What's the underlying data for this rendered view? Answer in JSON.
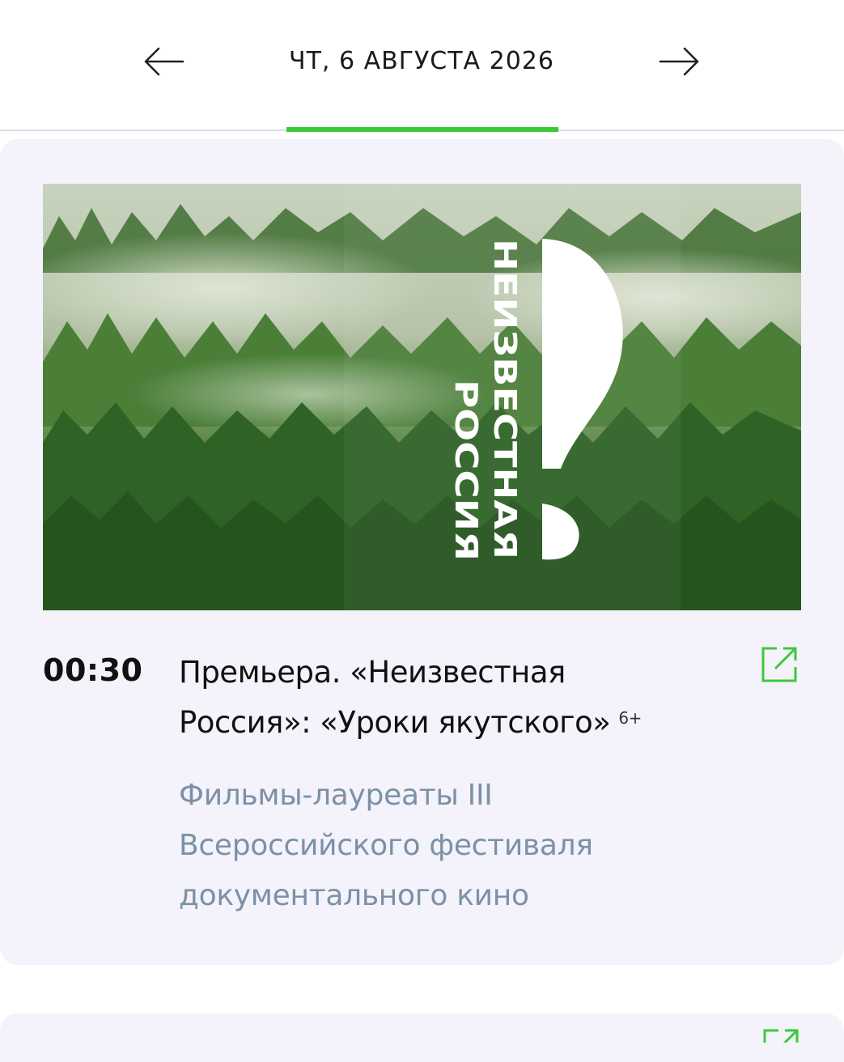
{
  "header": {
    "date": "ЧТ, 6 АВГУСТА 2026"
  },
  "colors": {
    "accent": "#3cc93a",
    "card_background": "#f4f2fa",
    "description_text": "#7c91a7"
  },
  "program": {
    "time": "00:30",
    "title": "Премьера. «Неизвестная Россия»: «Уроки якутского»",
    "age_rating": "6+",
    "description": "Фильмы-лауреаты III Всероссийского фестиваля документального кино",
    "image": {
      "logo_text_line1": "НЕИЗВЕСТНАЯ",
      "logo_text_line2": "РОССИЯ"
    }
  },
  "icons": {
    "prev": "arrow-left-icon",
    "next": "arrow-right-icon",
    "external": "external-link-icon"
  }
}
